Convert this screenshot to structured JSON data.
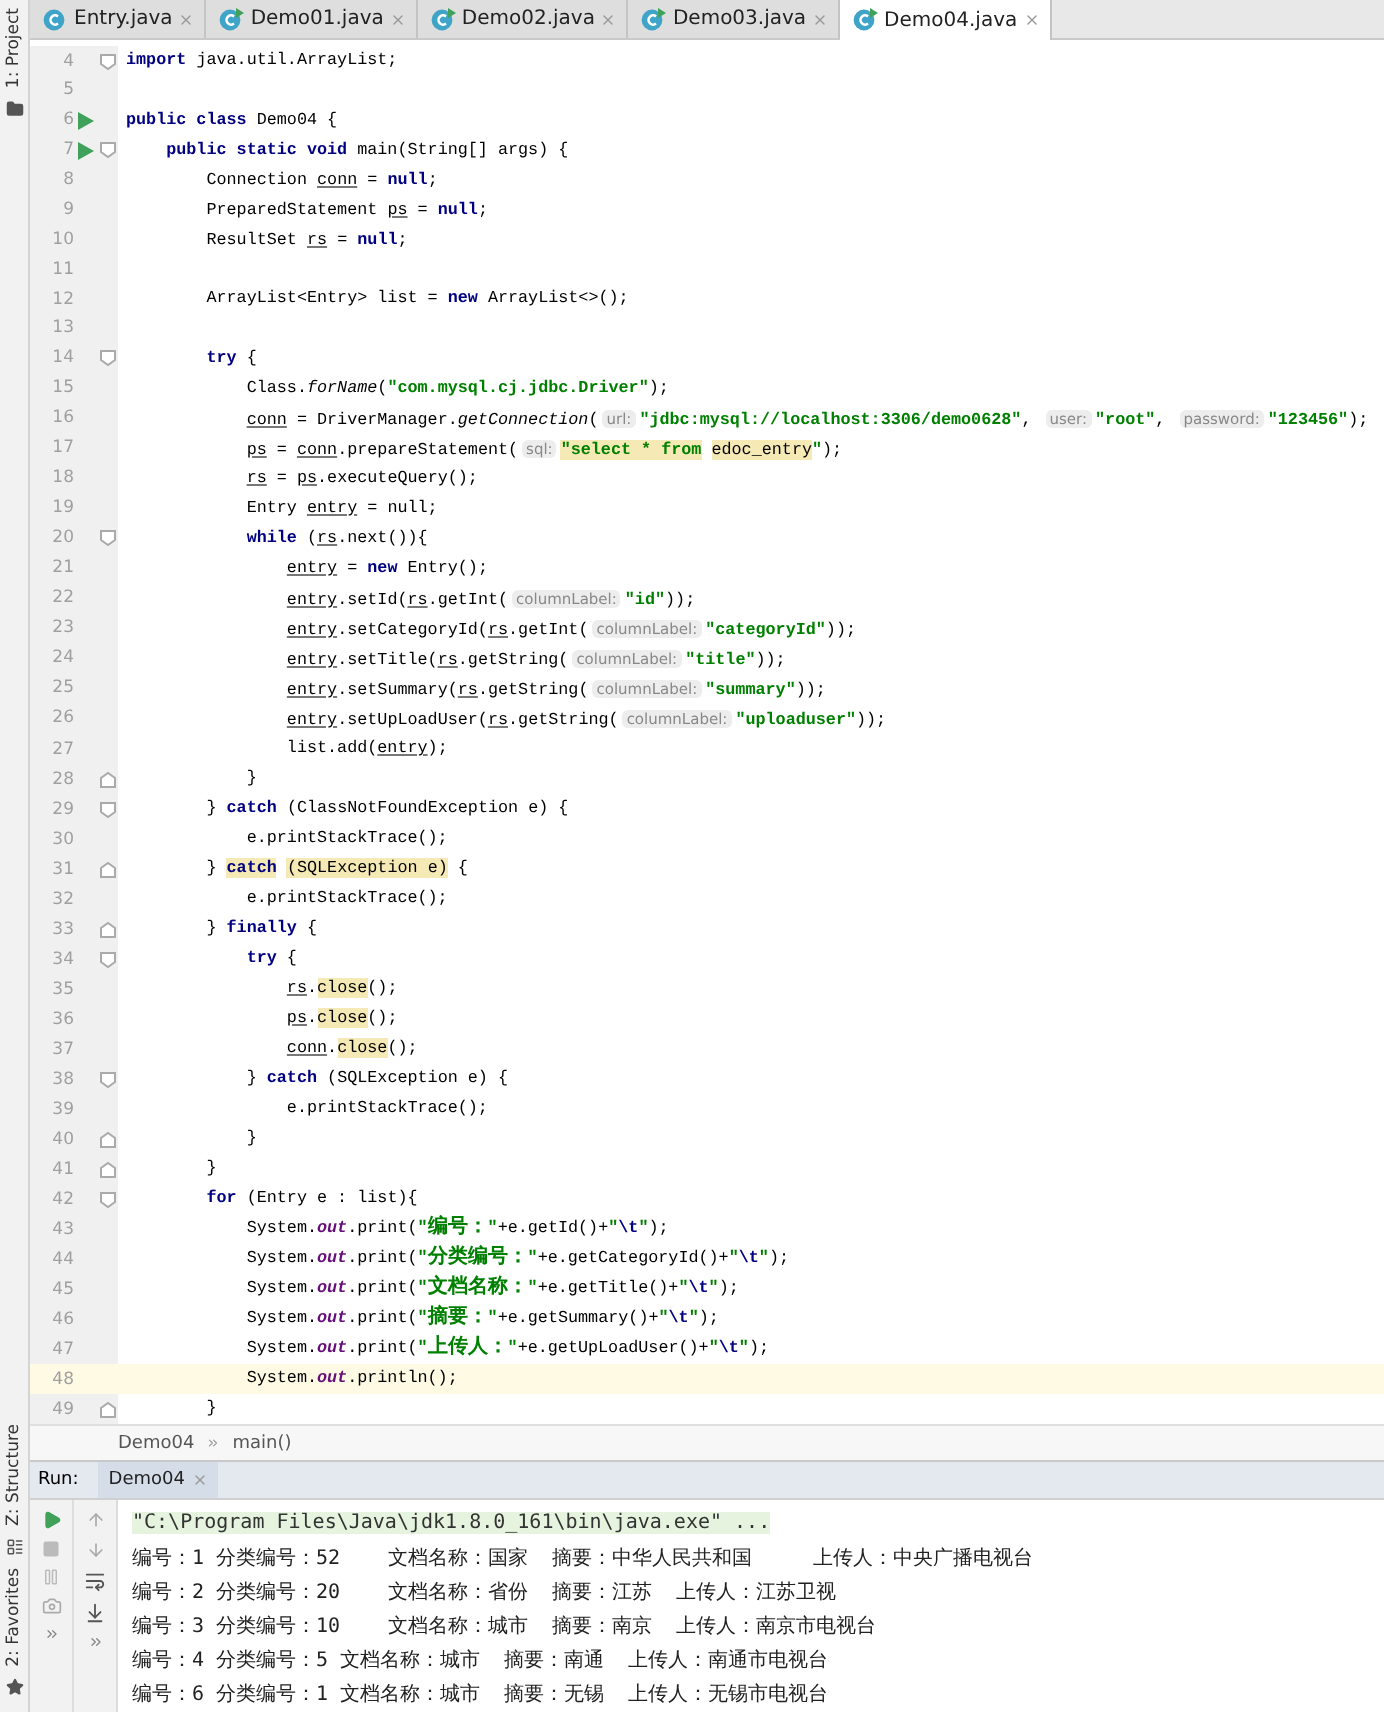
{
  "side_tools": {
    "top": [
      {
        "label": "1: Project"
      }
    ],
    "bottom": [
      {
        "label": "Z: Structure"
      },
      {
        "label": "2: Favorites"
      }
    ]
  },
  "tabs": [
    {
      "label": "Entry.java",
      "selected": false,
      "runnable": false
    },
    {
      "label": "Demo01.java",
      "selected": false,
      "runnable": true
    },
    {
      "label": "Demo02.java",
      "selected": false,
      "runnable": true
    },
    {
      "label": "Demo03.java",
      "selected": false,
      "runnable": true
    },
    {
      "label": "Demo04.java",
      "selected": true,
      "runnable": true
    }
  ],
  "editor": {
    "lines": [
      {
        "n": "4",
        "fold_start": true,
        "tokens": [
          {
            "t": "import",
            "kind": "keyword"
          },
          {
            "t": " java.util.ArrayList;",
            "kind": "plain"
          }
        ]
      },
      {
        "n": "5"
      },
      {
        "n": "6",
        "run": true,
        "tokens": [
          {
            "t": "public class",
            "kind": "keyword"
          },
          {
            "t": " Demo04 {",
            "kind": "plain"
          }
        ]
      },
      {
        "n": "7",
        "run": true,
        "fold_start": true,
        "tokens": [
          {
            "t": "    public static void",
            "kind": "keyword"
          },
          {
            "t": " main(String[] args) {",
            "kind": "plain"
          }
        ]
      },
      {
        "n": "8",
        "tokens": [
          {
            "t": "        Connection ",
            "kind": "plain"
          },
          {
            "t": "conn",
            "kind": "var"
          },
          {
            "t": " = ",
            "kind": "plain"
          },
          {
            "t": "null",
            "kind": "keyword"
          },
          {
            "t": ";",
            "kind": "plain"
          }
        ]
      },
      {
        "n": "9",
        "tokens": [
          {
            "t": "        PreparedStatement ",
            "kind": "plain"
          },
          {
            "t": "ps",
            "kind": "var"
          },
          {
            "t": " = ",
            "kind": "plain"
          },
          {
            "t": "null",
            "kind": "keyword"
          },
          {
            "t": ";",
            "kind": "plain"
          }
        ]
      },
      {
        "n": "10",
        "tokens": [
          {
            "t": "        ResultSet ",
            "kind": "plain"
          },
          {
            "t": "rs",
            "kind": "var"
          },
          {
            "t": " = ",
            "kind": "plain"
          },
          {
            "t": "null",
            "kind": "keyword"
          },
          {
            "t": ";",
            "kind": "plain"
          }
        ]
      },
      {
        "n": "11"
      },
      {
        "n": "12",
        "tokens": [
          {
            "t": "        ArrayList<Entry> list = ",
            "kind": "plain"
          },
          {
            "t": "new",
            "kind": "keyword"
          },
          {
            "t": " ArrayList<>();",
            "kind": "plain"
          }
        ]
      },
      {
        "n": "13"
      },
      {
        "n": "14",
        "fold_start": true,
        "tokens": [
          {
            "t": "        try",
            "kind": "keyword"
          },
          {
            "t": " {",
            "kind": "plain"
          }
        ]
      },
      {
        "n": "15",
        "tokens": [
          {
            "t": "            Class.",
            "kind": "plain"
          },
          {
            "t": "forName",
            "kind": "method"
          },
          {
            "t": "(",
            "kind": "plain"
          },
          {
            "t": "\"com.mysql.cj.jdbc.Driver\"",
            "kind": "string"
          },
          {
            "t": ");",
            "kind": "plain"
          }
        ]
      },
      {
        "n": "16",
        "tokens": [
          {
            "t": "            conn",
            "kind": "var"
          },
          {
            "t": " = DriverManager.",
            "kind": "plain"
          },
          {
            "t": "getConnection",
            "kind": "method"
          },
          {
            "t": "(",
            "kind": "plain"
          },
          {
            "t": "url:",
            "kind": "hint"
          },
          {
            "t": "\"jdbc:mysql://localhost:3306/demo0628\"",
            "kind": "string"
          },
          {
            "t": ", ",
            "kind": "plain"
          },
          {
            "t": "user:",
            "kind": "hint"
          },
          {
            "t": "\"root\"",
            "kind": "string"
          },
          {
            "t": ", ",
            "kind": "plain"
          },
          {
            "t": "password:",
            "kind": "hint"
          },
          {
            "t": "\"123456\"",
            "kind": "string"
          },
          {
            "t": ");",
            "kind": "plain"
          }
        ]
      },
      {
        "n": "17",
        "tokens": [
          {
            "t": "            ps",
            "kind": "var"
          },
          {
            "t": " = ",
            "kind": "plain"
          },
          {
            "t": "conn",
            "kind": "var"
          },
          {
            "t": ".prepareStatement(",
            "kind": "plain"
          },
          {
            "t": "sql:",
            "kind": "hint"
          },
          {
            "t": "\"select * from",
            "kind": "string",
            "hl": true
          },
          {
            "t": " edoc_entry",
            "kind": "plain",
            "hl": true
          },
          {
            "t": "\"",
            "kind": "string"
          },
          {
            "t": ");",
            "kind": "plain"
          }
        ]
      },
      {
        "n": "18",
        "tokens": [
          {
            "t": "            rs",
            "kind": "var"
          },
          {
            "t": " = ",
            "kind": "plain"
          },
          {
            "t": "ps",
            "kind": "var"
          },
          {
            "t": ".executeQuery();",
            "kind": "plain"
          }
        ]
      },
      {
        "n": "19",
        "tokens": [
          {
            "t": "            Entry ",
            "kind": "plain"
          },
          {
            "t": "entry",
            "kind": "var"
          },
          {
            "t": " = null;",
            "kind": "plain"
          }
        ]
      },
      {
        "n": "20",
        "fold_start": true,
        "tokens": [
          {
            "t": "            while",
            "kind": "keyword"
          },
          {
            "t": " (",
            "kind": "plain"
          },
          {
            "t": "rs",
            "kind": "var"
          },
          {
            "t": ".next()){",
            "kind": "plain"
          }
        ]
      },
      {
        "n": "21",
        "tokens": [
          {
            "t": "                entry",
            "kind": "var"
          },
          {
            "t": " = ",
            "kind": "plain"
          },
          {
            "t": "new",
            "kind": "keyword"
          },
          {
            "t": " Entry();",
            "kind": "plain"
          }
        ]
      },
      {
        "n": "22",
        "tokens": [
          {
            "t": "                entry",
            "kind": "var"
          },
          {
            "t": ".setId(",
            "kind": "plain"
          },
          {
            "t": "rs",
            "kind": "var"
          },
          {
            "t": ".getInt(",
            "kind": "plain"
          },
          {
            "t": "columnLabel:",
            "kind": "hint"
          },
          {
            "t": "\"id\"",
            "kind": "string"
          },
          {
            "t": "));",
            "kind": "plain"
          }
        ]
      },
      {
        "n": "23",
        "tokens": [
          {
            "t": "                entry",
            "kind": "var"
          },
          {
            "t": ".setCategoryId(",
            "kind": "plain"
          },
          {
            "t": "rs",
            "kind": "var"
          },
          {
            "t": ".getInt(",
            "kind": "plain"
          },
          {
            "t": "columnLabel:",
            "kind": "hint"
          },
          {
            "t": "\"categoryId\"",
            "kind": "string"
          },
          {
            "t": "));",
            "kind": "plain"
          }
        ]
      },
      {
        "n": "24",
        "tokens": [
          {
            "t": "                entry",
            "kind": "var"
          },
          {
            "t": ".setTitle(",
            "kind": "plain"
          },
          {
            "t": "rs",
            "kind": "var"
          },
          {
            "t": ".getString(",
            "kind": "plain"
          },
          {
            "t": "columnLabel:",
            "kind": "hint"
          },
          {
            "t": "\"title\"",
            "kind": "string"
          },
          {
            "t": "));",
            "kind": "plain"
          }
        ]
      },
      {
        "n": "25",
        "tokens": [
          {
            "t": "                entry",
            "kind": "var"
          },
          {
            "t": ".setSummary(",
            "kind": "plain"
          },
          {
            "t": "rs",
            "kind": "var"
          },
          {
            "t": ".getString(",
            "kind": "plain"
          },
          {
            "t": "columnLabel:",
            "kind": "hint"
          },
          {
            "t": "\"summary\"",
            "kind": "string"
          },
          {
            "t": "));",
            "kind": "plain"
          }
        ]
      },
      {
        "n": "26",
        "tokens": [
          {
            "t": "                entry",
            "kind": "var"
          },
          {
            "t": ".setUpLoadUser(",
            "kind": "plain"
          },
          {
            "t": "rs",
            "kind": "var"
          },
          {
            "t": ".getString(",
            "kind": "plain"
          },
          {
            "t": "columnLabel:",
            "kind": "hint"
          },
          {
            "t": "\"uploaduser\"",
            "kind": "string"
          },
          {
            "t": "));",
            "kind": "plain"
          }
        ]
      },
      {
        "n": "27",
        "tokens": [
          {
            "t": "                list.add(",
            "kind": "plain"
          },
          {
            "t": "entry",
            "kind": "var"
          },
          {
            "t": ");",
            "kind": "plain"
          }
        ]
      },
      {
        "n": "28",
        "fold_end": true,
        "tokens": [
          {
            "t": "            }",
            "kind": "plain"
          }
        ]
      },
      {
        "n": "29",
        "fold_start": true,
        "tokens": [
          {
            "t": "        } ",
            "kind": "plain"
          },
          {
            "t": "catch",
            "kind": "keyword"
          },
          {
            "t": " (ClassNotFoundException e) {",
            "kind": "plain"
          }
        ]
      },
      {
        "n": "30",
        "tokens": [
          {
            "t": "            e.printStackTrace();",
            "kind": "plain"
          }
        ]
      },
      {
        "n": "31",
        "fold_end": true,
        "tokens": [
          {
            "t": "        } ",
            "kind": "plain"
          },
          {
            "t": "catch",
            "kind": "keyword",
            "hl": true
          },
          {
            "t": " (SQLException e)",
            "kind": "plain",
            "hl": true
          },
          {
            "t": " {",
            "kind": "plain"
          }
        ]
      },
      {
        "n": "32",
        "tokens": [
          {
            "t": "            e.printStackTrace();",
            "kind": "plain"
          }
        ]
      },
      {
        "n": "33",
        "fold_end": true,
        "tokens": [
          {
            "t": "        } ",
            "kind": "plain"
          },
          {
            "t": "finally",
            "kind": "keyword"
          },
          {
            "t": " {",
            "kind": "plain"
          }
        ]
      },
      {
        "n": "34",
        "fold_start": true,
        "tokens": [
          {
            "t": "            try",
            "kind": "keyword"
          },
          {
            "t": " {",
            "kind": "plain"
          }
        ]
      },
      {
        "n": "35",
        "tokens": [
          {
            "t": "                rs",
            "kind": "var"
          },
          {
            "t": ".",
            "kind": "plain"
          },
          {
            "t": "close",
            "kind": "plain",
            "hl": true
          },
          {
            "t": "();",
            "kind": "plain"
          }
        ]
      },
      {
        "n": "36",
        "tokens": [
          {
            "t": "                ps",
            "kind": "var"
          },
          {
            "t": ".",
            "kind": "plain"
          },
          {
            "t": "close",
            "kind": "plain",
            "hl": true
          },
          {
            "t": "();",
            "kind": "plain"
          }
        ]
      },
      {
        "n": "37",
        "tokens": [
          {
            "t": "                conn",
            "kind": "var"
          },
          {
            "t": ".",
            "kind": "plain"
          },
          {
            "t": "close",
            "kind": "plain",
            "hl": true
          },
          {
            "t": "();",
            "kind": "plain"
          }
        ]
      },
      {
        "n": "38",
        "fold_start": true,
        "tokens": [
          {
            "t": "            } ",
            "kind": "plain"
          },
          {
            "t": "catch",
            "kind": "keyword"
          },
          {
            "t": " (SQLException e) {",
            "kind": "plain"
          }
        ]
      },
      {
        "n": "39",
        "tokens": [
          {
            "t": "                e.printStackTrace();",
            "kind": "plain"
          }
        ]
      },
      {
        "n": "40",
        "fold_end": true,
        "tokens": [
          {
            "t": "            }",
            "kind": "plain"
          }
        ]
      },
      {
        "n": "41",
        "fold_end": true,
        "tokens": [
          {
            "t": "        }",
            "kind": "plain"
          }
        ]
      },
      {
        "n": "42",
        "fold_start": true,
        "tokens": [
          {
            "t": "        for",
            "kind": "keyword"
          },
          {
            "t": " (Entry e : list){",
            "kind": "plain"
          }
        ]
      },
      {
        "n": "43",
        "tokens": [
          {
            "t": "            System.",
            "kind": "plain"
          },
          {
            "t": "out",
            "kind": "field"
          },
          {
            "t": ".print(",
            "kind": "plain"
          },
          {
            "t": "\"编号：\"",
            "kind": "string"
          },
          {
            "t": "+e.getId()+",
            "kind": "plain"
          },
          {
            "t": "\"",
            "kind": "string"
          },
          {
            "t": "\\t",
            "kind": "escape"
          },
          {
            "t": "\"",
            "kind": "string"
          },
          {
            "t": ");",
            "kind": "plain"
          }
        ]
      },
      {
        "n": "44",
        "tokens": [
          {
            "t": "            System.",
            "kind": "plain"
          },
          {
            "t": "out",
            "kind": "field"
          },
          {
            "t": ".print(",
            "kind": "plain"
          },
          {
            "t": "\"分类编号：\"",
            "kind": "string"
          },
          {
            "t": "+e.getCategoryId()+",
            "kind": "plain"
          },
          {
            "t": "\"",
            "kind": "string"
          },
          {
            "t": "\\t",
            "kind": "escape"
          },
          {
            "t": "\"",
            "kind": "string"
          },
          {
            "t": ");",
            "kind": "plain"
          }
        ]
      },
      {
        "n": "45",
        "tokens": [
          {
            "t": "            System.",
            "kind": "plain"
          },
          {
            "t": "out",
            "kind": "field"
          },
          {
            "t": ".print(",
            "kind": "plain"
          },
          {
            "t": "\"文档名称：\"",
            "kind": "string"
          },
          {
            "t": "+e.getTitle()+",
            "kind": "plain"
          },
          {
            "t": "\"",
            "kind": "string"
          },
          {
            "t": "\\t",
            "kind": "escape"
          },
          {
            "t": "\"",
            "kind": "string"
          },
          {
            "t": ");",
            "kind": "plain"
          }
        ]
      },
      {
        "n": "46",
        "tokens": [
          {
            "t": "            System.",
            "kind": "plain"
          },
          {
            "t": "out",
            "kind": "field"
          },
          {
            "t": ".print(",
            "kind": "plain"
          },
          {
            "t": "\"摘要：\"",
            "kind": "string"
          },
          {
            "t": "+e.getSummary()+",
            "kind": "plain"
          },
          {
            "t": "\"",
            "kind": "string"
          },
          {
            "t": "\\t",
            "kind": "escape"
          },
          {
            "t": "\"",
            "kind": "string"
          },
          {
            "t": ");",
            "kind": "plain"
          }
        ]
      },
      {
        "n": "47",
        "tokens": [
          {
            "t": "            System.",
            "kind": "plain"
          },
          {
            "t": "out",
            "kind": "field"
          },
          {
            "t": ".print(",
            "kind": "plain"
          },
          {
            "t": "\"上传人：\"",
            "kind": "string"
          },
          {
            "t": "+e.getUpLoadUser()+",
            "kind": "plain"
          },
          {
            "t": "\"",
            "kind": "string"
          },
          {
            "t": "\\t",
            "kind": "escape"
          },
          {
            "t": "\"",
            "kind": "string"
          },
          {
            "t": ");",
            "kind": "plain"
          }
        ]
      },
      {
        "n": "48",
        "current": true,
        "tokens": [
          {
            "t": "            System.",
            "kind": "plain"
          },
          {
            "t": "out",
            "kind": "field"
          },
          {
            "t": ".println();",
            "kind": "plain"
          }
        ]
      },
      {
        "n": "49",
        "fold_end": true,
        "tokens": [
          {
            "t": "        }",
            "kind": "plain"
          }
        ]
      }
    ]
  },
  "breadcrumb": [
    "Demo04",
    "main()"
  ],
  "run_panel": {
    "label": "Run:",
    "tab": "Demo04",
    "lines": [
      {
        "kind": "command",
        "text": "\"C:\\Program Files\\Java\\jdk1.8.0_161\\bin\\java.exe\" ..."
      },
      {
        "kind": "output",
        "text": "编号：1 分类编号：52    文档名称：国家  摘要：中华人民共和国     上传人：中央广播电视台"
      },
      {
        "kind": "output",
        "text": "编号：2 分类编号：20    文档名称：省份  摘要：江苏  上传人：江苏卫视"
      },
      {
        "kind": "output",
        "text": "编号：3 分类编号：10    文档名称：城市  摘要：南京  上传人：南京市电视台"
      },
      {
        "kind": "output",
        "text": "编号：4 分类编号：5 文档名称：城市  摘要：南通  上传人：南通市电视台"
      },
      {
        "kind": "output",
        "text": "编号：6 分类编号：1 文档名称：城市  摘要：无锡  上传人：无锡市电视台"
      }
    ]
  }
}
